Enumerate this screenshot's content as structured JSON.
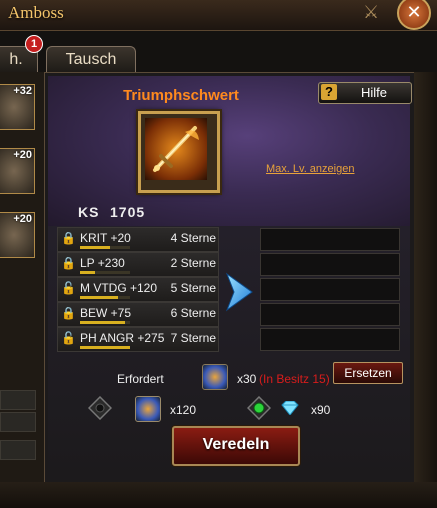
{
  "window": {
    "title": "Amboss"
  },
  "tabs": [
    {
      "label": "h."
    },
    {
      "label": "Tausch"
    }
  ],
  "tab_badge": "1",
  "left_items": [
    {
      "level": "+32"
    },
    {
      "level": "+20"
    },
    {
      "level": "+20"
    }
  ],
  "item": {
    "name": "Triumphschwert",
    "icon": "sword-icon"
  },
  "help_button": {
    "q": "?",
    "label": "Hilfe"
  },
  "max_level_link": "Max. Lv. anzeigen",
  "ks": {
    "label": "KS",
    "value": "1705"
  },
  "stats": [
    {
      "name": "KRIT +20",
      "stars": "4 Sterne",
      "locked": true,
      "bar": 0.6
    },
    {
      "name": "LP +230",
      "stars": "2 Sterne",
      "locked": true,
      "bar": 0.3
    },
    {
      "name": "M VTDG +120",
      "stars": "5 Sterne",
      "locked": false,
      "bar": 0.75
    },
    {
      "name": "BEW +75",
      "stars": "6 Sterne",
      "locked": true,
      "bar": 0.9
    },
    {
      "name": "PH ANGR +275",
      "stars": "7 Sterne",
      "locked": false,
      "bar": 1.0
    }
  ],
  "requirement": {
    "label": "Erfordert",
    "quantity": "x30",
    "owned_note": "(In Besitz 15)",
    "gem_quantity": "x120",
    "diamond_quantity": "x90"
  },
  "replace_button": "Ersetzen",
  "refine_button": "Veredeln",
  "colors": {
    "item_name": "#ff8a1e",
    "owned_note": "#d81c1c",
    "stat_bar": "#d8b020"
  }
}
